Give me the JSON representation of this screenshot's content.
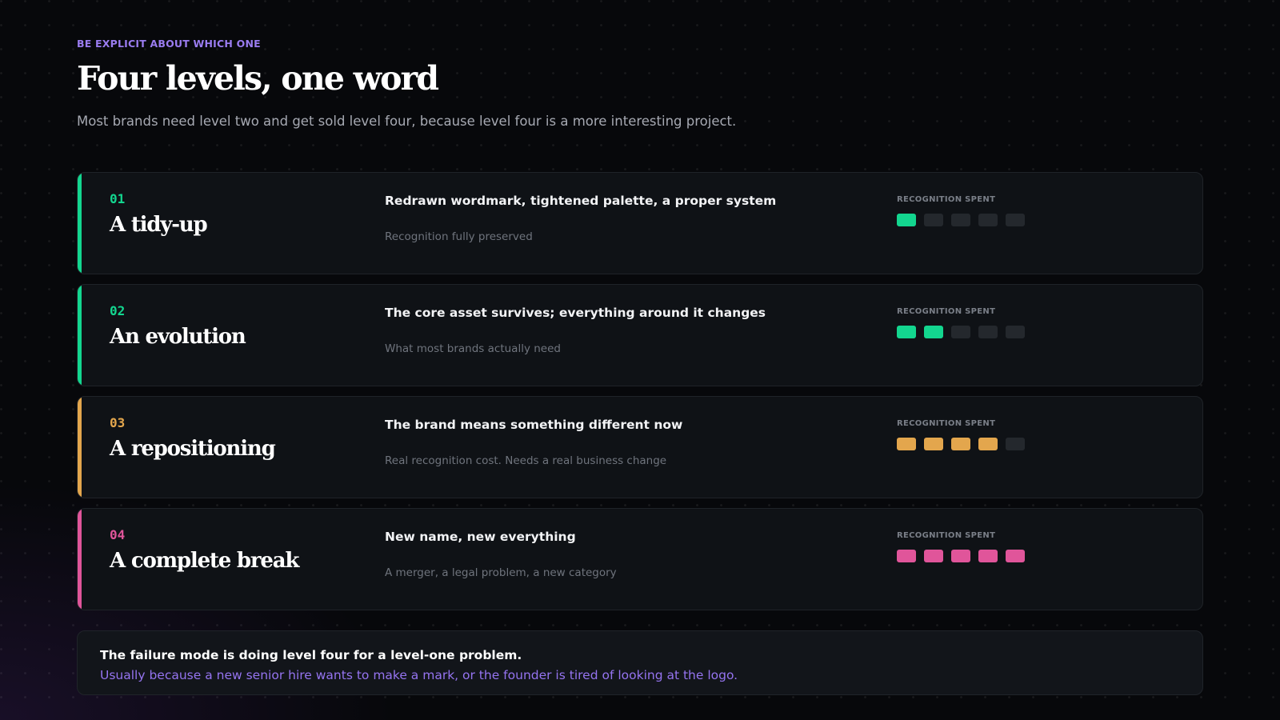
{
  "header": {
    "eyebrow": "Be explicit about which one",
    "title": "Four levels, one word",
    "subtitle": "Most brands need level two and get sold level four, because level four is a more interesting project."
  },
  "colors": {
    "accent_purple": "#9a7cf0",
    "green": "#13d68f",
    "amber": "#e3a64d",
    "pink": "#e0559a",
    "empty_square": "#24282d"
  },
  "levels": [
    {
      "number": "01",
      "name": "A tidy-up",
      "description": "Redrawn wordmark, tightened palette, a proper system",
      "note": "Recognition fully preserved",
      "meter_label": "Recognition spent",
      "spent": 1,
      "total": 5,
      "color": "#13d68f"
    },
    {
      "number": "02",
      "name": "An evolution",
      "description": "The core asset survives; everything around it changes",
      "note": "What most brands actually need",
      "meter_label": "Recognition spent",
      "spent": 2,
      "total": 5,
      "color": "#13d68f"
    },
    {
      "number": "03",
      "name": "A repositioning",
      "description": "The brand means something different now",
      "note": "Real recognition cost. Needs a real business change",
      "meter_label": "Recognition spent",
      "spent": 4,
      "total": 5,
      "color": "#e3a64d"
    },
    {
      "number": "04",
      "name": "A complete break",
      "description": "New name, new everything",
      "note": "A merger, a legal problem, a new category",
      "meter_label": "Recognition spent",
      "spent": 5,
      "total": 5,
      "color": "#e0559a"
    }
  ],
  "callout": {
    "lead": "The failure mode is doing level four for a level-one problem.",
    "follow": "Usually because a new senior hire wants to make a mark, or the founder is tired of looking at the logo."
  }
}
